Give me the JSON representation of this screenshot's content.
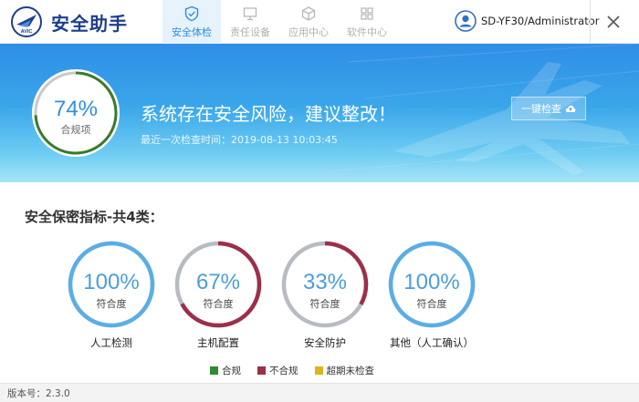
{
  "app": {
    "title": "安全助手",
    "logo_text": "AVIC"
  },
  "tabs": [
    {
      "label": "安全体检",
      "icon": "shield-check-icon",
      "active": true
    },
    {
      "label": "责任设备",
      "icon": "monitor-icon",
      "active": false
    },
    {
      "label": "应用中心",
      "icon": "cube-icon",
      "active": false
    },
    {
      "label": "软件中心",
      "icon": "apps-icon",
      "active": false
    }
  ],
  "user": {
    "name": "SD-YF30/Administrator",
    "icon": "user-avatar-icon"
  },
  "banner": {
    "score": "74%",
    "score_fraction": 0.74,
    "score_label": "合规项",
    "message": "系统存在安全风险，建议整改！",
    "last_check": "最近一次检查时间：2019-08-13 10:03:45",
    "check_button": "一键检查"
  },
  "indicators": {
    "title": "安全保密指标-共4类：",
    "items": [
      {
        "value": "100%",
        "fraction": 1.0,
        "sub": "符合度",
        "name": "人工检测"
      },
      {
        "value": "67%",
        "fraction": 0.67,
        "sub": "符合度",
        "name": "主机配置"
      },
      {
        "value": "33%",
        "fraction": 0.33,
        "sub": "符合度",
        "name": "安全防护"
      },
      {
        "value": "100%",
        "fraction": 1.0,
        "sub": "符合度",
        "name": "其他（人工确认）"
      }
    ]
  },
  "legend": [
    {
      "label": "合规",
      "color": "#2e8b2e"
    },
    {
      "label": "不合规",
      "color": "#9c2f4a"
    },
    {
      "label": "超期未检查",
      "color": "#e0b220"
    }
  ],
  "colors": {
    "accent": "#2d8fe0",
    "ring_blue": "#5aaee6",
    "ring_fail": "#9c2f4a",
    "ring_gray": "#b8bcc0"
  },
  "footer": {
    "version": "版本号：2.3.0"
  }
}
